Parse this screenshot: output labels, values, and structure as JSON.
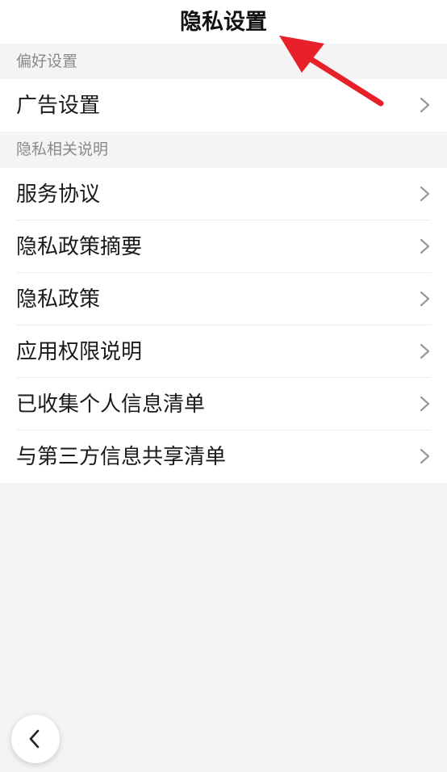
{
  "header": {
    "title": "隐私设置"
  },
  "sections": [
    {
      "label": "偏好设置",
      "items": [
        {
          "label": "广告设置",
          "icon": "chevron-right-icon"
        }
      ]
    },
    {
      "label": "隐私相关说明",
      "items": [
        {
          "label": "服务协议",
          "icon": "chevron-right-icon"
        },
        {
          "label": "隐私政策摘要",
          "icon": "chevron-right-icon"
        },
        {
          "label": "隐私政策",
          "icon": "chevron-right-icon"
        },
        {
          "label": "应用权限说明",
          "icon": "chevron-right-icon"
        },
        {
          "label": "已收集个人信息清单",
          "icon": "chevron-right-icon"
        },
        {
          "label": "与第三方信息共享清单",
          "icon": "chevron-right-icon"
        }
      ]
    }
  ],
  "back_button": {
    "icon": "chevron-left-icon"
  },
  "colors": {
    "background": "#f4f4f4",
    "surface": "#ffffff",
    "section_label": "#8a8a8a",
    "chevron": "#999999",
    "annotation_arrow": "#e8202a"
  }
}
